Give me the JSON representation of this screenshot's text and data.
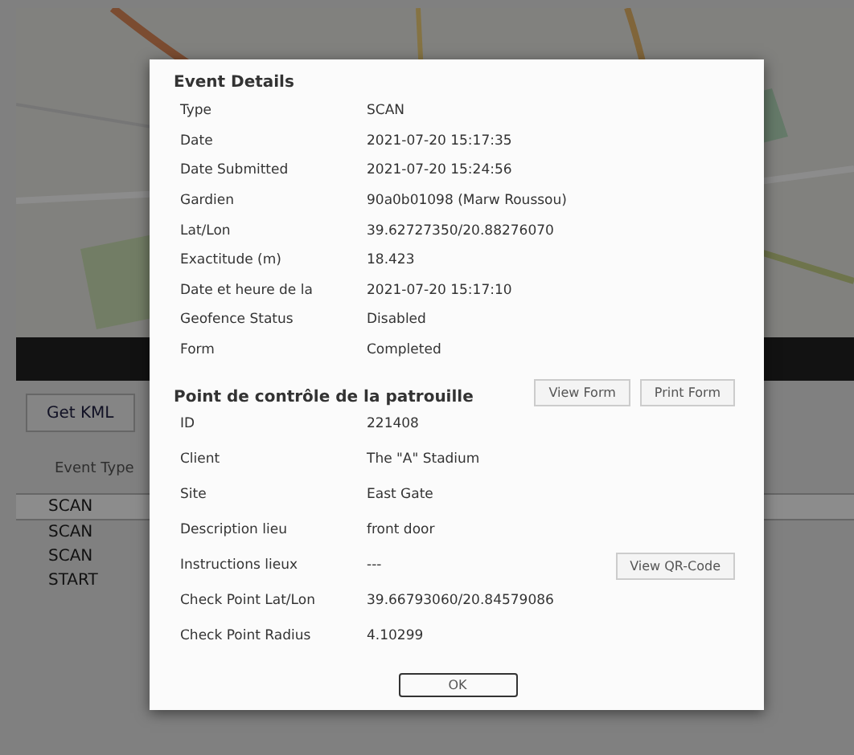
{
  "background": {
    "toolbar": {
      "buttons": [
        "Get KML"
      ]
    },
    "table": {
      "columns": [
        "Event Type"
      ],
      "rows": [
        {
          "event_type": "SCAN",
          "selected": true
        },
        {
          "event_type": "SCAN",
          "selected": false
        },
        {
          "event_type": "SCAN",
          "selected": false
        },
        {
          "event_type": "START",
          "selected": false
        }
      ]
    }
  },
  "dialog": {
    "title": "Event Details",
    "fields": [
      {
        "label": "Type",
        "value": "SCAN"
      },
      {
        "label": "Date",
        "value": "2021-07-20 15:17:35"
      },
      {
        "label": "Date Submitted",
        "value": "2021-07-20 15:24:56"
      },
      {
        "label": "Gardien",
        "value": "90a0b01098 (Marw Roussou)"
      },
      {
        "label": "Lat/Lon",
        "value": "39.62727350/20.88276070"
      },
      {
        "label": "Exactitude (m)",
        "value": "18.423"
      },
      {
        "label": "Date et heure de la",
        "value": "2021-07-20 15:17:10"
      },
      {
        "label": "Geofence Status",
        "value": "Disabled"
      },
      {
        "label": "Form",
        "value": "Completed"
      }
    ],
    "section": {
      "title": "Point de contrôle de la patrouille",
      "buttons": [
        "View Form",
        "Print Form"
      ],
      "fields": [
        {
          "label": "ID",
          "value": "221408"
        },
        {
          "label": "Client",
          "value": "The \"A\" Stadium"
        },
        {
          "label": "Site",
          "value": "East Gate"
        },
        {
          "label": "Description lieu",
          "value": "front door"
        },
        {
          "label": "Instructions lieux",
          "value": "---",
          "button": "View QR-Code"
        },
        {
          "label": "Check Point Lat/Lon",
          "value": "39.66793060/20.84579086"
        },
        {
          "label": "Check Point Radius",
          "value": "4.10299"
        }
      ]
    },
    "ok_button": "OK"
  }
}
